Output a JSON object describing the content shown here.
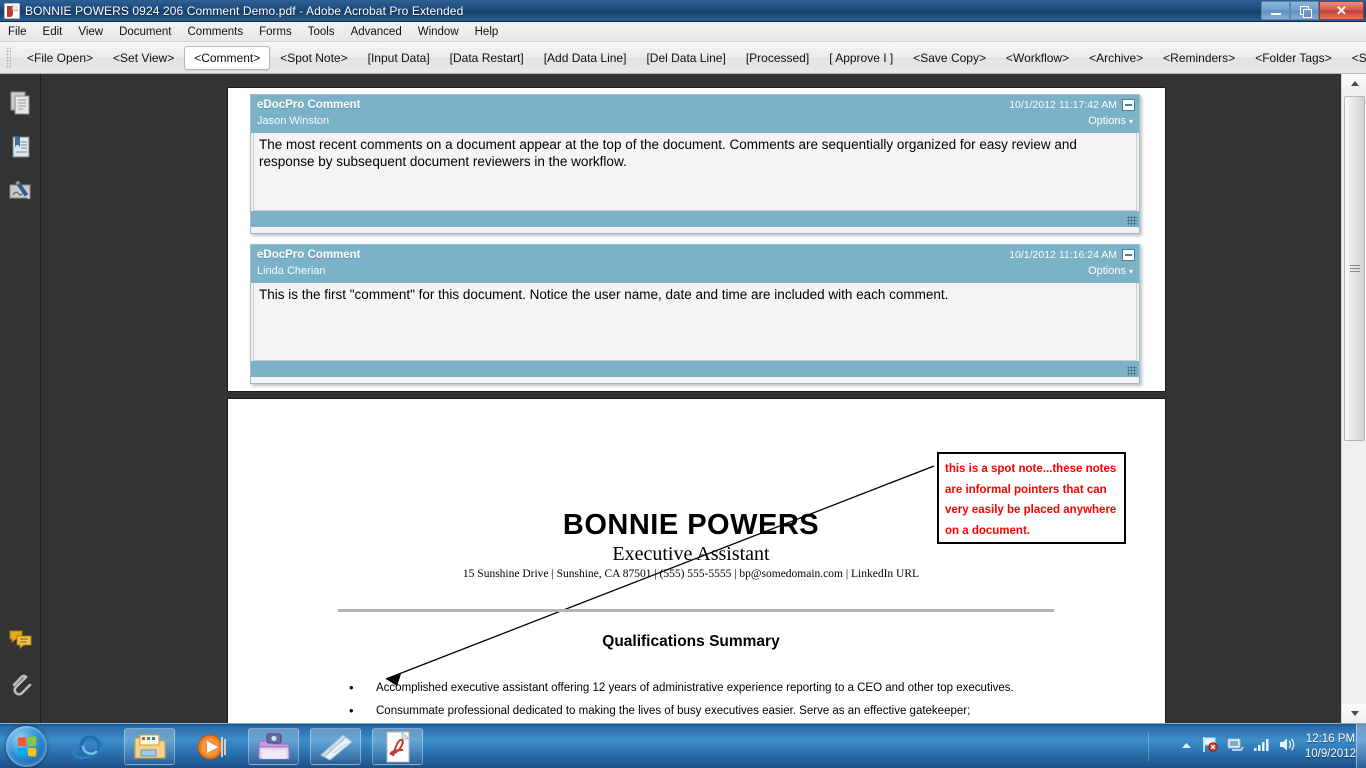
{
  "window": {
    "title": "BONNIE POWERS 0924 206 Comment Demo.pdf - Adobe Acrobat Pro Extended",
    "app_icon": "acrobat-icon",
    "minimize_label": "Minimize",
    "restore_label": "Restore",
    "close_label": "Close"
  },
  "menubar": {
    "items": [
      {
        "label": "File"
      },
      {
        "label": "Edit"
      },
      {
        "label": "View"
      },
      {
        "label": "Document"
      },
      {
        "label": "Comments"
      },
      {
        "label": "Forms"
      },
      {
        "label": "Tools"
      },
      {
        "label": "Advanced"
      },
      {
        "label": "Window"
      },
      {
        "label": "Help"
      }
    ]
  },
  "toolbar": {
    "buttons": [
      {
        "label": "<File Open>",
        "active": false
      },
      {
        "label": "<Set View>",
        "active": false
      },
      {
        "label": "<Comment>",
        "active": true
      },
      {
        "label": "<Spot Note>",
        "active": false
      },
      {
        "label": "[Input Data]",
        "active": false
      },
      {
        "label": "[Data Restart]",
        "active": false
      },
      {
        "label": "[Add Data Line]",
        "active": false
      },
      {
        "label": "[Del Data Line]",
        "active": false
      },
      {
        "label": "[Processed]",
        "active": false
      },
      {
        "label": "[ Approve I ]",
        "active": false
      },
      {
        "label": "<Save Copy>",
        "active": false
      },
      {
        "label": "<Workflow>",
        "active": false
      },
      {
        "label": "<Archive>",
        "active": false
      },
      {
        "label": "<Reminders>",
        "active": false
      },
      {
        "label": "<Folder Tags>",
        "active": false
      },
      {
        "label": "<Search>",
        "active": false
      }
    ]
  },
  "navrail": {
    "items": [
      {
        "name": "pages-panel",
        "icon": "pages-thumbnail-icon"
      },
      {
        "name": "bookmarks-panel",
        "icon": "bookmark-icon"
      },
      {
        "name": "signatures-panel",
        "icon": "signature-pen-icon"
      },
      {
        "name": "comments-panel",
        "icon": "comment-bubbles-icon"
      },
      {
        "name": "attachments-panel",
        "icon": "paperclip-icon"
      }
    ]
  },
  "comments": [
    {
      "title": "eDocPro Comment",
      "author": "Jason Winston",
      "date": "10/1/2012 11:17:42 AM",
      "options_label": "Options",
      "options_caret": "▾",
      "body": "The most recent comments on a document appear at the top of the document.  Comments are sequentially organized for easy review and response by subsequent document reviewers in the workflow."
    },
    {
      "title": "eDocPro Comment",
      "author": "Linda Cherian",
      "date": "10/1/2012 11:16:24 AM",
      "options_label": "Options",
      "options_caret": "▾",
      "body": "This is the first \"comment\" for this document.  Notice the user name, date and time are included with each comment."
    }
  ],
  "spot_note": {
    "text": "this is a spot note...these notes are informal pointers that can very easily be placed anywhere on a document.",
    "text_color": "#ff0000",
    "border_color": "#000000"
  },
  "resume": {
    "name": "BONNIE POWERS",
    "role": "Executive Assistant",
    "contact": "15 Sunshine Drive | Sunshine, CA 87501 | (555) 555-5555 | bp@somedomain.com | LinkedIn URL",
    "section_heading": "Qualifications Summary",
    "bullets": [
      "Accomplished executive assistant offering 12 years of administrative experience reporting to a CEO and other top executives.",
      "Consummate professional dedicated to making the lives of busy executives easier. Serve as an effective gatekeeper;"
    ]
  },
  "taskbar": {
    "start_label": "Start",
    "apps": [
      {
        "name": "internet-explorer",
        "icon": "internet-explorer-icon"
      },
      {
        "name": "windows-explorer",
        "icon": "folder-icon"
      },
      {
        "name": "windows-media-player",
        "icon": "media-player-icon"
      },
      {
        "name": "scanner-folder",
        "icon": "purple-folder-icon"
      },
      {
        "name": "sticky-notes",
        "icon": "notepad-icon"
      },
      {
        "name": "adobe-acrobat",
        "icon": "acrobat-icon"
      }
    ],
    "tray": [
      {
        "name": "show-hidden-icons",
        "icon": "chevron-up-icon"
      },
      {
        "name": "action-center",
        "icon": "flag-alert-icon"
      },
      {
        "name": "network-connection",
        "icon": "network-icon"
      },
      {
        "name": "signal-strength",
        "icon": "signal-bars-icon"
      },
      {
        "name": "volume",
        "icon": "speaker-icon"
      }
    ],
    "clock_time": "12:16 PM",
    "clock_date": "10/9/2012"
  },
  "colors": {
    "comment_header": "#7bb2c8",
    "title_bar": "#1d4a7c",
    "doc_background": "#333333",
    "accent_red": "#ff0000"
  }
}
